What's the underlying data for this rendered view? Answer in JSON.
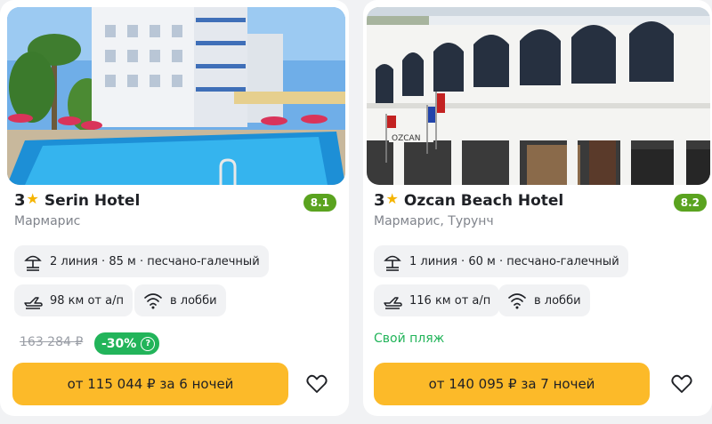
{
  "cards": [
    {
      "stars": "3",
      "name": "Serin Hotel",
      "rating": "8.1",
      "location": "Мармарис",
      "beach_info": "2 линия · 85 м · песчано-галечный",
      "airport": "98 км от а/п",
      "wifi": "в лобби",
      "old_price": "163 284 ₽",
      "discount": "-30%",
      "price_button": "от 115 044 ₽ за 6 ночей"
    },
    {
      "stars": "3",
      "name": "Ozcan Beach Hotel",
      "rating": "8.2",
      "location": "Мармарис, Турунч",
      "beach_info": "1 линия · 60 м · песчано-галечный",
      "airport": "116 км от а/п",
      "wifi": "в лобби",
      "tag": "Свой пляж",
      "price_button": "от 140 095 ₽ за 7 ночей"
    }
  ],
  "icons": {
    "star": "star-icon",
    "beach": "beach-umbrella-icon",
    "plane": "airplane-icon",
    "wifi": "wifi-icon",
    "heart": "heart-icon",
    "info": "info-icon"
  },
  "colors": {
    "price_button": "#fcba29",
    "rating_badge": "#5aa31f",
    "discount_badge": "#22b45a",
    "own_beach_text": "#22b45a",
    "star": "#f5b400"
  }
}
